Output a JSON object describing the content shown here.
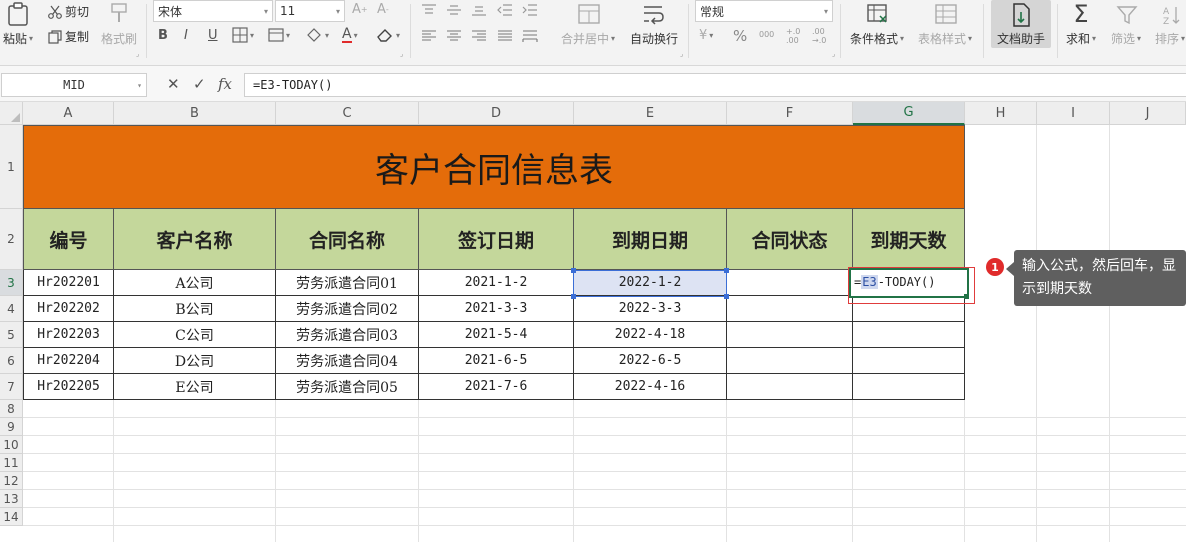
{
  "ribbon": {
    "paste": "粘贴",
    "cut": "剪切",
    "copy": "复制",
    "format_painter": "格式刷",
    "font_name": "宋体",
    "font_size": "11",
    "bold": "B",
    "italic": "I",
    "underline": "U",
    "merge_center": "合并居中",
    "wrap_text": "自动换行",
    "number_format": "常规",
    "conditional_format": "条件格式",
    "table_style": "表格样式",
    "doc_assistant": "文档助手",
    "sum": "求和",
    "filter": "筛选",
    "sort": "排序",
    "percent": "%",
    "thousands": "000",
    "inc_decimal": "+.0 .00",
    "dec_decimal": ".00 →.0"
  },
  "formula_bar": {
    "name_box": "MID",
    "fx": "fx",
    "formula": "=E3-TODAY()"
  },
  "columns": [
    "A",
    "B",
    "C",
    "D",
    "E",
    "F",
    "G",
    "H",
    "I",
    "J"
  ],
  "rows": [
    "1",
    "2",
    "3",
    "4",
    "5",
    "6",
    "7",
    "8",
    "9",
    "10",
    "11",
    "12",
    "13",
    "14"
  ],
  "sheet": {
    "title": "客户合同信息表",
    "headers": [
      "编号",
      "客户名称",
      "合同名称",
      "签订日期",
      "到期日期",
      "合同状态",
      "到期天数"
    ],
    "data": [
      [
        "Hr202201",
        "A公司",
        "劳务派遣合同01",
        "2021-1-2",
        "2022-1-2"
      ],
      [
        "Hr202202",
        "B公司",
        "劳务派遣合同02",
        "2021-3-3",
        "2022-3-3"
      ],
      [
        "Hr202203",
        "C公司",
        "劳务派遣合同03",
        "2021-5-4",
        "2022-4-18"
      ],
      [
        "Hr202204",
        "D公司",
        "劳务派遣合同04",
        "2021-6-5",
        "2022-6-5"
      ],
      [
        "Hr202205",
        "E公司",
        "劳务派遣合同05",
        "2021-7-6",
        "2022-4-16"
      ]
    ],
    "edit_prefix": "=",
    "edit_ref": "E3",
    "edit_suffix": "-TODAY()"
  },
  "callout": {
    "badge": "1",
    "text": "输入公式，然后回车，显示到期天数"
  },
  "colors": {
    "title_bg": "#e46c0a",
    "header_bg": "#c4d79b",
    "selection": "#217346",
    "reference": "#3b6ed6"
  }
}
